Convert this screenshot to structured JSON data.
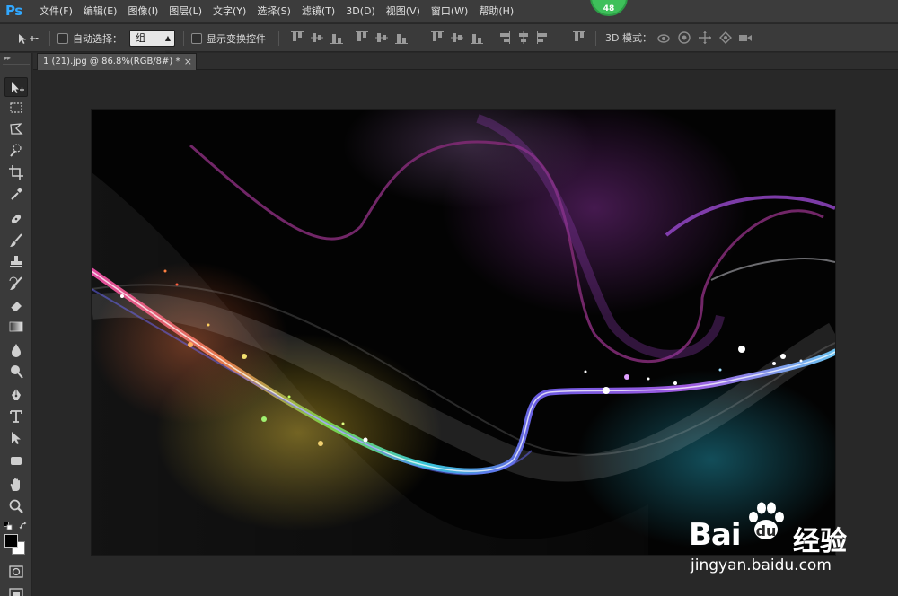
{
  "app": {
    "logo": "Ps",
    "perf_badge": "48"
  },
  "menu": {
    "items": [
      {
        "id": "file",
        "label": "文件(F)"
      },
      {
        "id": "edit",
        "label": "编辑(E)"
      },
      {
        "id": "image",
        "label": "图像(I)"
      },
      {
        "id": "layer",
        "label": "图层(L)"
      },
      {
        "id": "type",
        "label": "文字(Y)"
      },
      {
        "id": "select",
        "label": "选择(S)"
      },
      {
        "id": "filter",
        "label": "滤镜(T)"
      },
      {
        "id": "3d",
        "label": "3D(D)"
      },
      {
        "id": "view",
        "label": "视图(V)"
      },
      {
        "id": "window",
        "label": "窗口(W)"
      },
      {
        "id": "help",
        "label": "帮助(H)"
      }
    ]
  },
  "options_bar": {
    "auto_select_label": "自动选择：",
    "auto_select_value": "组",
    "show_transform_label": "显示变换控件",
    "mode_3d_label": "3D 模式：",
    "align_icons": [
      "align-top-edges-icon",
      "align-vertical-centers-icon",
      "align-bottom-edges-icon",
      "align-left-edges-icon",
      "align-horizontal-centers-icon",
      "align-right-edges-icon",
      "distribute-top-icon",
      "distribute-vertical-centers-icon",
      "distribute-bottom-icon",
      "distribute-left-icon",
      "distribute-horizontal-centers-icon",
      "distribute-right-icon",
      "auto-align-layers-icon"
    ],
    "mode_3d_icons": [
      "rotate-3d-icon",
      "roll-3d-icon",
      "pan-3d-icon",
      "slide-3d-icon",
      "scale-3d-icon"
    ]
  },
  "tools": [
    {
      "id": "move",
      "icon": "move-tool-icon",
      "active": true
    },
    {
      "id": "marquee",
      "icon": "rectangular-marquee-icon"
    },
    {
      "id": "lasso",
      "icon": "polygonal-lasso-icon"
    },
    {
      "id": "quick-select",
      "icon": "quick-selection-icon"
    },
    {
      "id": "crop",
      "icon": "crop-tool-icon"
    },
    {
      "id": "eyedropper",
      "icon": "eyedropper-icon"
    },
    {
      "id": "healing",
      "icon": "spot-healing-brush-icon"
    },
    {
      "id": "brush",
      "icon": "brush-tool-icon"
    },
    {
      "id": "stamp",
      "icon": "clone-stamp-icon"
    },
    {
      "id": "history-brush",
      "icon": "history-brush-icon"
    },
    {
      "id": "eraser",
      "icon": "eraser-icon"
    },
    {
      "id": "gradient",
      "icon": "gradient-tool-icon"
    },
    {
      "id": "blur",
      "icon": "blur-tool-icon"
    },
    {
      "id": "dodge",
      "icon": "dodge-tool-icon"
    },
    {
      "id": "pen",
      "icon": "pen-tool-icon"
    },
    {
      "id": "type",
      "icon": "type-tool-icon"
    },
    {
      "id": "path-select",
      "icon": "path-selection-icon"
    },
    {
      "id": "shape",
      "icon": "rectangle-shape-icon"
    },
    {
      "id": "hand",
      "icon": "hand-tool-icon"
    },
    {
      "id": "zoom",
      "icon": "zoom-tool-icon"
    }
  ],
  "colors": {
    "foreground": "#000000",
    "background": "#ffffff",
    "accent": "#31a8ff",
    "badge": "#3ec05a"
  },
  "document": {
    "tab_title": "1 (21).jpg @ 86.8%(RGB/8#) *",
    "close_glyph": "×"
  },
  "watermark": {
    "brand": "Bai",
    "brand_suffix": "经验",
    "url": "jingyan.baidu.com"
  }
}
